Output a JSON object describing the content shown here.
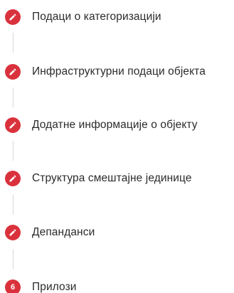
{
  "theme": {
    "accent": "#d9323d",
    "connector": "#d8d8d8",
    "text": "#2b2b2b"
  },
  "steps": [
    {
      "label": "Подаци о категоризацији",
      "state": "completed",
      "icon": "pencil-icon"
    },
    {
      "label": "Инфраструктурни подаци објекта",
      "state": "completed",
      "icon": "pencil-icon"
    },
    {
      "label": "Додатне информације о објекту",
      "state": "completed",
      "icon": "pencil-icon"
    },
    {
      "label": "Структура смештајне јединице",
      "state": "completed",
      "icon": "pencil-icon"
    },
    {
      "label": "Депанданси",
      "state": "completed",
      "icon": "pencil-icon"
    },
    {
      "label": "Прилози",
      "state": "active",
      "number": "6"
    }
  ]
}
